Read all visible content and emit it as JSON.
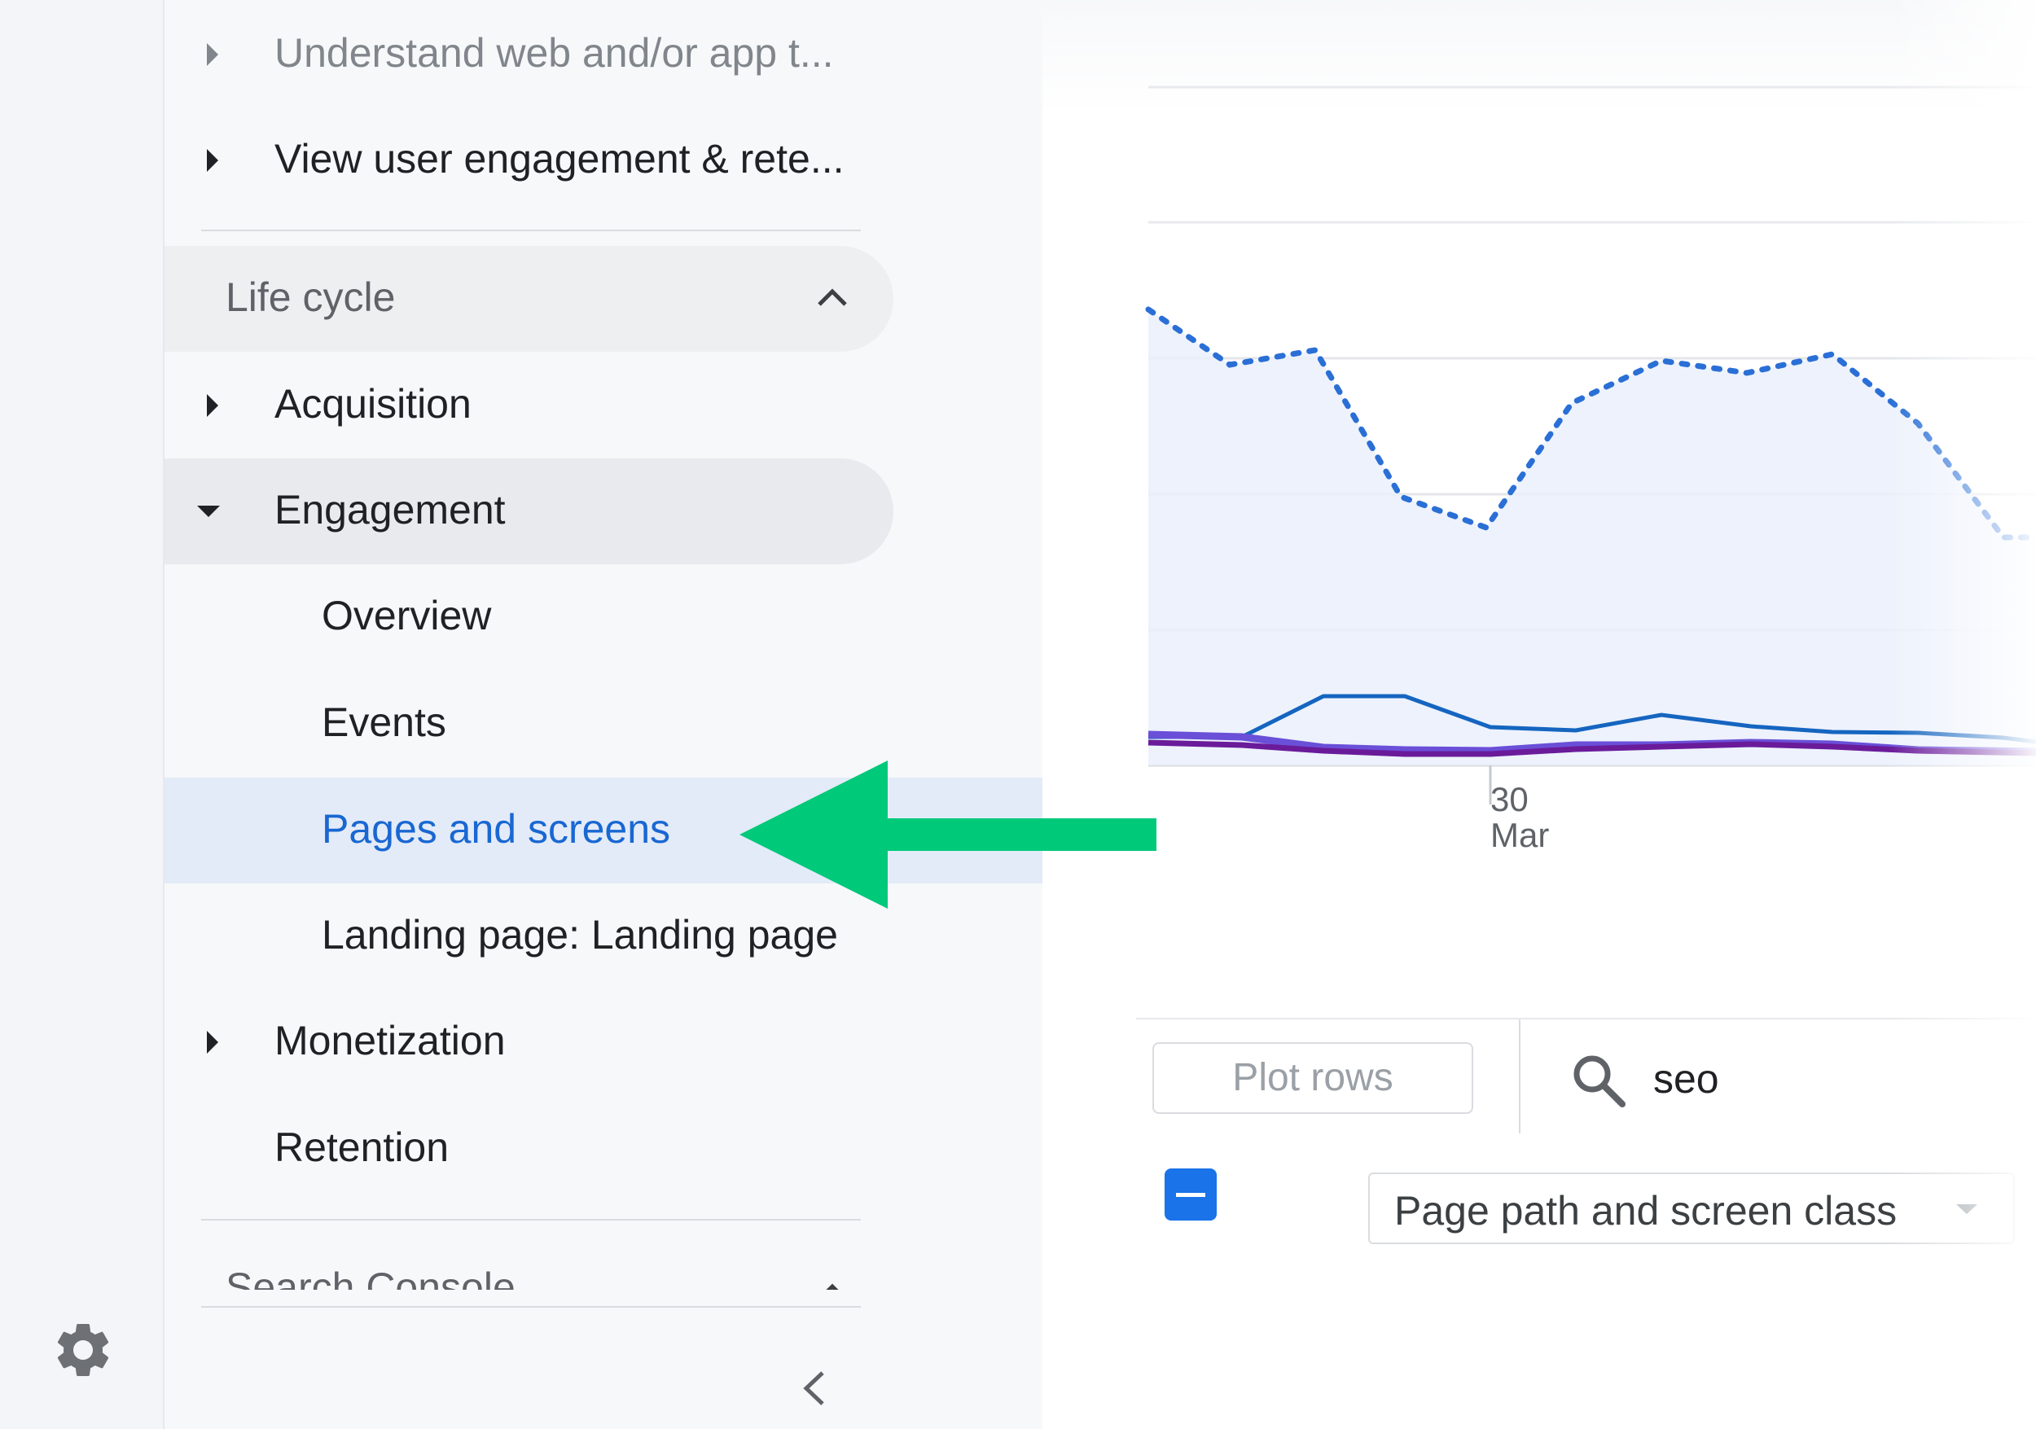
{
  "sidebar": {
    "items": [
      {
        "label": "Understand web and/or app t..."
      },
      {
        "label": "View user engagement & rete..."
      }
    ],
    "section_lifecycle": {
      "label": "Life cycle"
    },
    "acquisition": {
      "label": "Acquisition"
    },
    "engagement": {
      "label": "Engagement",
      "children": [
        {
          "label": "Overview"
        },
        {
          "label": "Events"
        },
        {
          "label": "Pages and screens",
          "selected": true
        },
        {
          "label": "Landing page: Landing page"
        }
      ]
    },
    "monetization": {
      "label": "Monetization"
    },
    "retention": {
      "label": "Retention"
    },
    "section_search_console": {
      "label": "Search Console"
    }
  },
  "chart": {
    "x_tick": {
      "day": "30",
      "month": "Mar"
    }
  },
  "table_controls": {
    "plot_rows_label": "Plot rows",
    "search_value": "seo",
    "dimension_label": "Page path and screen class"
  },
  "colors": {
    "accent": "#1a73e8",
    "selected_text": "#1967d2",
    "annotation_arrow": "#00c97a"
  },
  "icons": [
    "gear-icon",
    "chevron-up-icon",
    "caret-right-icon",
    "caret-down-icon",
    "chevron-left-icon",
    "search-icon"
  ]
}
